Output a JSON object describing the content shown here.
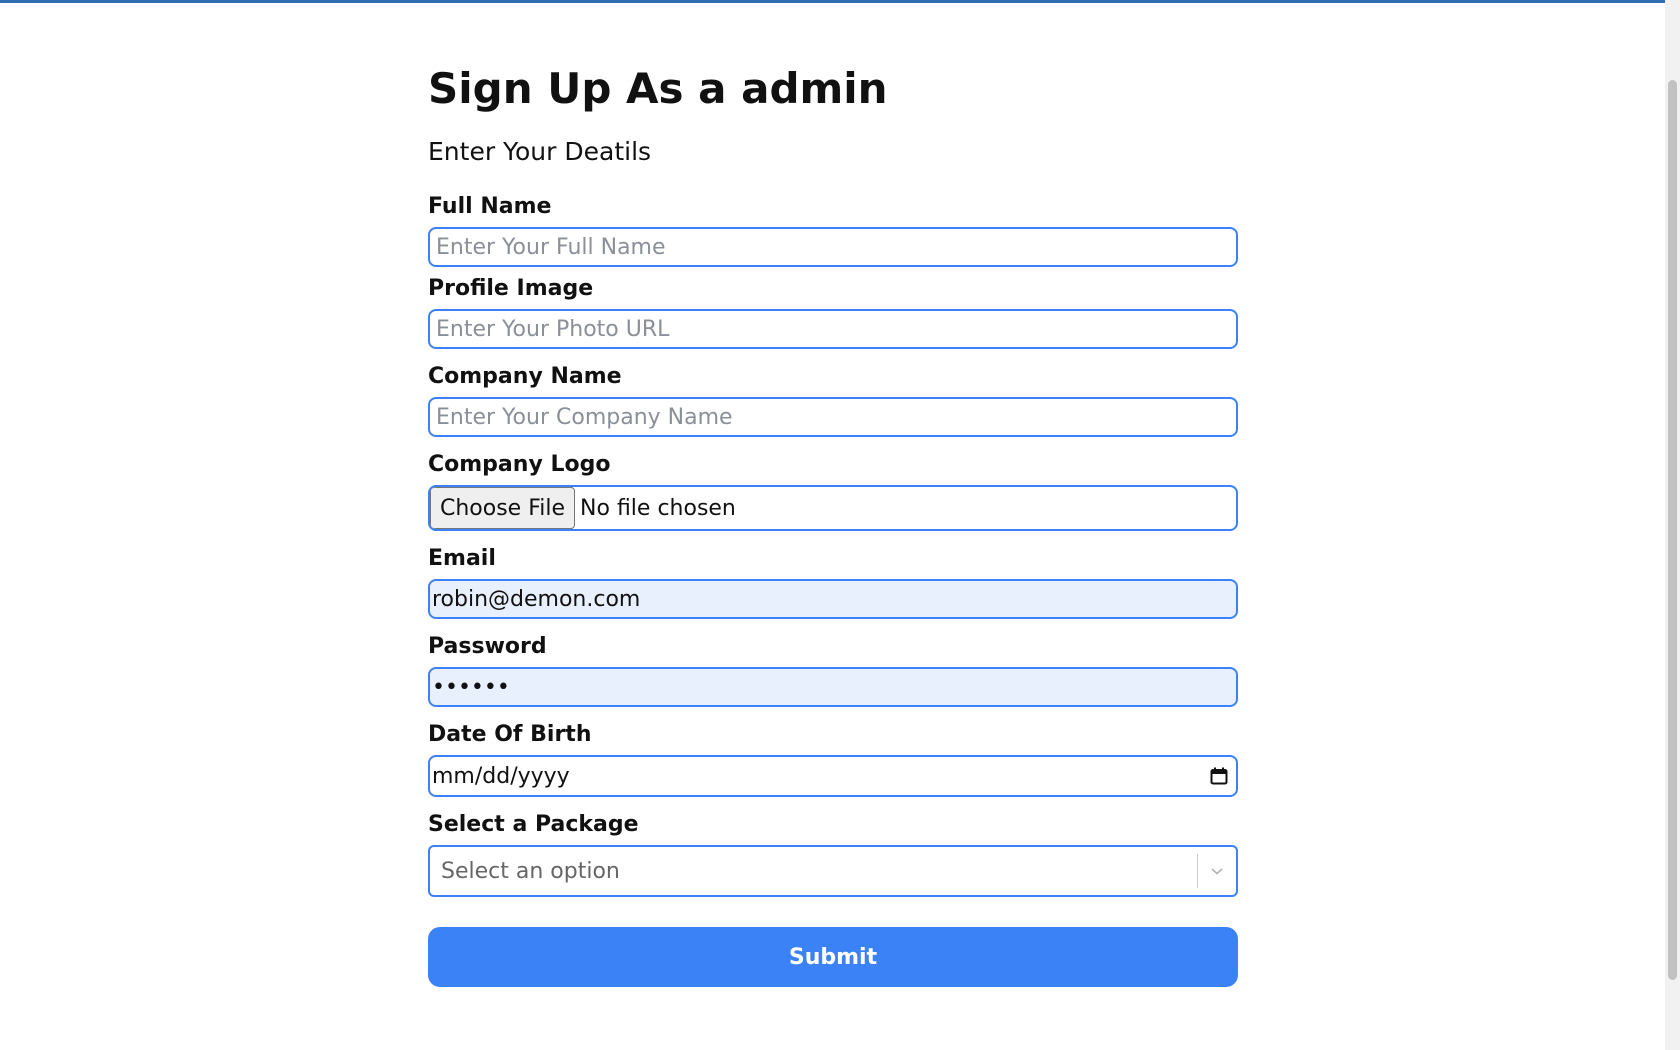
{
  "header": {
    "title": "Sign Up As a admin",
    "subtitle": "Enter Your Deatils"
  },
  "fields": {
    "full_name": {
      "label": "Full Name",
      "placeholder": "Enter Your Full Name"
    },
    "profile_image": {
      "label": "Profile Image",
      "placeholder": "Enter Your Photo URL"
    },
    "company_name": {
      "label": "Company Name",
      "placeholder": "Enter Your Company Name"
    },
    "company_logo": {
      "label": "Company Logo",
      "button": "Choose File",
      "status": "No file chosen"
    },
    "email": {
      "label": "Email",
      "value": "robin@demon.com"
    },
    "password": {
      "label": "Password",
      "value": "••••••"
    },
    "dob": {
      "label": "Date Of Birth",
      "placeholder": "mm/dd/yyyy",
      "icon": "calendar-icon"
    },
    "package": {
      "label": "Select a Package",
      "placeholder": "Select an option",
      "icon": "chevron-down-icon"
    }
  },
  "submit_label": "Submit",
  "colors": {
    "accent": "#3b82f6",
    "top_bar": "#2f6db5",
    "autofill_bg": "#e8f0fe"
  }
}
